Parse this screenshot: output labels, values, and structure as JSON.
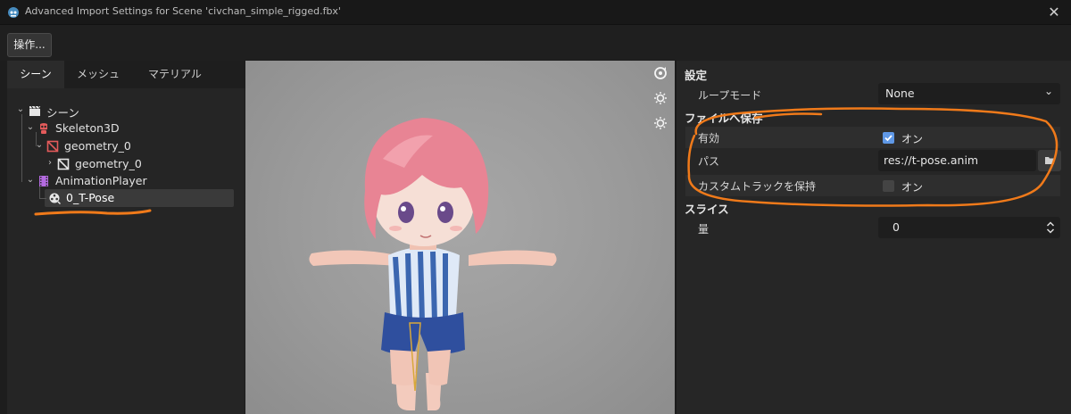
{
  "window": {
    "title": "Advanced Import Settings for Scene 'civchan_simple_rigged.fbx'",
    "close_glyph": "✕"
  },
  "toolbar": {
    "actions_label": "操作..."
  },
  "left_panel": {
    "tabs": [
      {
        "label": "シーン",
        "active": true
      },
      {
        "label": "メッシュ",
        "active": false
      },
      {
        "label": "マテリアル",
        "active": false
      }
    ],
    "tree": [
      {
        "label": "シーン",
        "icon": "clapperboard-icon",
        "expanded": true
      },
      {
        "label": "Skeleton3D",
        "icon": "skeleton-icon",
        "expanded": true
      },
      {
        "label": "geometry_0",
        "icon": "mesh-icon",
        "expanded": true
      },
      {
        "label": "geometry_0",
        "icon": "mesh-icon",
        "expanded": false
      },
      {
        "label": "AnimationPlayer",
        "icon": "film-icon",
        "expanded": true
      },
      {
        "label": "0_T-Pose",
        "icon": "animation-icon",
        "selected": true
      }
    ]
  },
  "viewport": {
    "icons": [
      "rotate-view-icon",
      "light-toggle-icon-1",
      "light-toggle-icon-2"
    ]
  },
  "inspector": {
    "settings_header": "設定",
    "loop_mode": {
      "label": "ループモード",
      "value": "None"
    },
    "save_to_file_header": "ファイルへ保存",
    "enabled": {
      "label": "有効",
      "checked": true,
      "text": "オン"
    },
    "path": {
      "label": "パス",
      "value": "res://t-pose.anim"
    },
    "keep_custom_tracks": {
      "label": "カスタムトラックを保持",
      "checked": false,
      "text": "オン"
    },
    "slice_header": "スライス",
    "amount": {
      "label": "量",
      "value": "0"
    }
  },
  "colors": {
    "annotation": "#f07a1a",
    "checkbox_on": "#5f98e6",
    "skeleton_icon": "#e35b5b",
    "animation_player_icon": "#b46be0"
  }
}
